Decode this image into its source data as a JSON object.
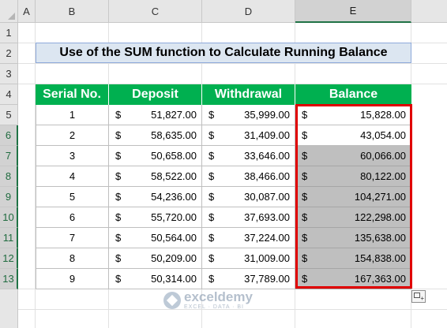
{
  "columns": [
    "A",
    "B",
    "C",
    "D",
    "E"
  ],
  "rows": [
    "1",
    "2",
    "3",
    "4",
    "5",
    "6",
    "7",
    "8",
    "9",
    "10",
    "11",
    "12",
    "13"
  ],
  "title": "Use of the SUM function to Calculate Running Balance",
  "table": {
    "headers": [
      "Serial No.",
      "Deposit",
      "Withdrawal",
      "Balance"
    ],
    "currency": "$",
    "rows": [
      {
        "serial": "1",
        "deposit": "51,827.00",
        "withdrawal": "35,999.00",
        "balance": "15,828.00"
      },
      {
        "serial": "2",
        "deposit": "58,635.00",
        "withdrawal": "31,409.00",
        "balance": "43,054.00"
      },
      {
        "serial": "3",
        "deposit": "50,658.00",
        "withdrawal": "33,646.00",
        "balance": "60,066.00"
      },
      {
        "serial": "4",
        "deposit": "58,522.00",
        "withdrawal": "38,466.00",
        "balance": "80,122.00"
      },
      {
        "serial": "5",
        "deposit": "54,236.00",
        "withdrawal": "30,087.00",
        "balance": "104,271.00"
      },
      {
        "serial": "6",
        "deposit": "55,720.00",
        "withdrawal": "37,693.00",
        "balance": "122,298.00"
      },
      {
        "serial": "7",
        "deposit": "50,564.00",
        "withdrawal": "37,224.00",
        "balance": "135,638.00"
      },
      {
        "serial": "8",
        "deposit": "50,209.00",
        "withdrawal": "31,009.00",
        "balance": "154,838.00"
      },
      {
        "serial": "9",
        "deposit": "50,314.00",
        "withdrawal": "37,789.00",
        "balance": "167,363.00"
      }
    ]
  },
  "watermark": {
    "name": "exceldemy",
    "sub": "EXCEL · DATA · BI"
  },
  "colors": {
    "header_green": "#00b050",
    "title_fill": "#dce6f1",
    "highlight": "#e00000",
    "selected_fill": "#bfbfbf"
  },
  "icons": {
    "quick_analysis": "quick-analysis-icon",
    "logo": "exceldemy-logo-icon"
  }
}
